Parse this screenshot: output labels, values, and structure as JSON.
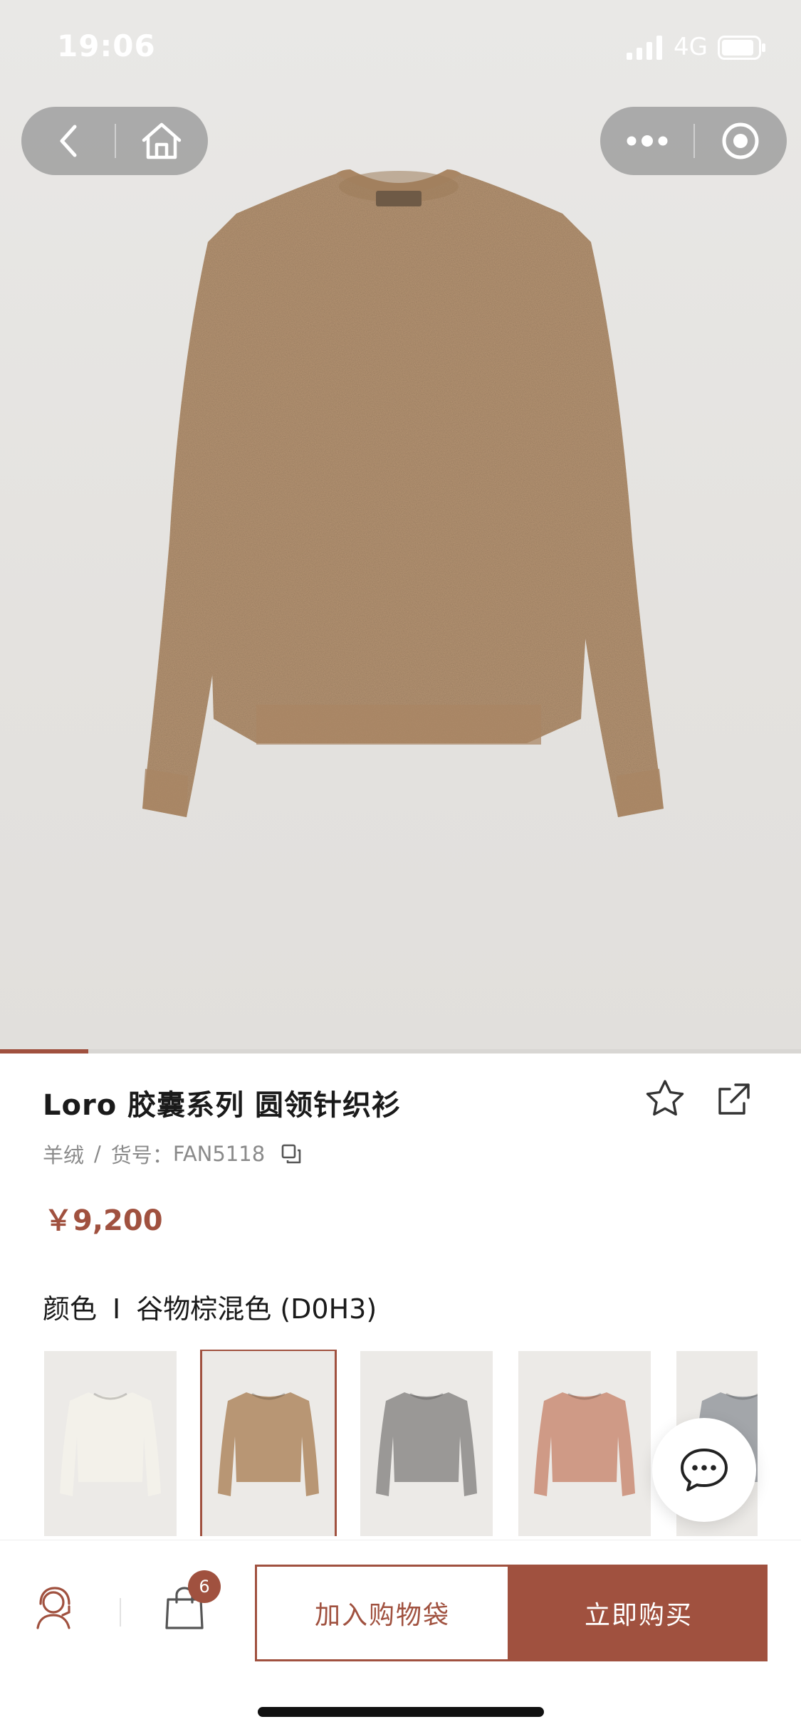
{
  "status_bar": {
    "time": "19:06",
    "network": "4G"
  },
  "product": {
    "title": "Loro 胶囊系列 圆领针织衫",
    "material": "羊绒",
    "sku_label": "货号",
    "sku_separator": "：",
    "sku": "FAN5118",
    "meta_separator": "/",
    "price": "￥9,200",
    "color_label": "颜色",
    "color_separator": "I",
    "color_name": "谷物棕混色 (D0H3)",
    "gallery_progress": 0.11
  },
  "swatches": [
    {
      "name": "ivory",
      "color": "#f3f1ea"
    },
    {
      "name": "grain-brown",
      "color": "#b89674",
      "selected": true
    },
    {
      "name": "grey",
      "color": "#9a9896"
    },
    {
      "name": "rose",
      "color": "#cf9a86"
    },
    {
      "name": "light-grey",
      "color": "#a3a6aa"
    }
  ],
  "bottom_bar": {
    "bag_count": "6",
    "add_to_bag": "加入购物袋",
    "buy_now": "立即购买"
  },
  "colors": {
    "accent": "#a0513f",
    "sweater": "#b89674"
  },
  "icons": {
    "back": "chevron-left-icon",
    "home": "home-icon",
    "more": "more-dots-icon",
    "close": "target-icon",
    "favorite": "star-icon",
    "share": "share-icon",
    "copy": "copy-icon",
    "chat": "chat-icon",
    "service": "customer-service-icon",
    "bag": "shopping-bag-icon"
  }
}
